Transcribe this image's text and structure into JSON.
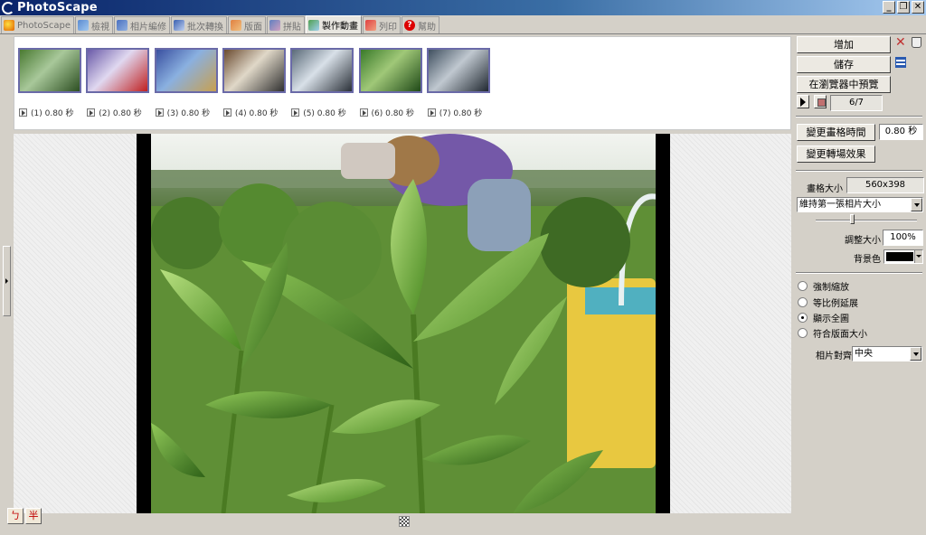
{
  "window": {
    "title": "PhotoScape",
    "controls": [
      "_",
      "❐",
      "✕"
    ]
  },
  "tabs": [
    {
      "label": "PhotoScape",
      "icon": "photoscape-icon",
      "active": false
    },
    {
      "label": "檢視",
      "icon": "viewer-icon",
      "active": false
    },
    {
      "label": "相片編修",
      "icon": "editor-icon",
      "active": false
    },
    {
      "label": "批次轉換",
      "icon": "batch-icon",
      "active": false
    },
    {
      "label": "版面",
      "icon": "page-icon",
      "active": false
    },
    {
      "label": "拼貼",
      "icon": "combine-icon",
      "active": false
    },
    {
      "label": "製作動畫",
      "icon": "gif-icon",
      "active": true
    },
    {
      "label": "列印",
      "icon": "print-icon",
      "active": false
    },
    {
      "label": "幫助",
      "icon": "help-icon",
      "active": false
    }
  ],
  "frames": [
    {
      "label": "(1) 0.80 秒",
      "colors": [
        "#4a7a32",
        "#a8c89a",
        "#2d4f22"
      ]
    },
    {
      "label": "(2) 0.80 秒",
      "colors": [
        "#6a5aa8",
        "#e0d8f0",
        "#c02020"
      ]
    },
    {
      "label": "(3) 0.80 秒",
      "colors": [
        "#3a50a0",
        "#8ab0e0",
        "#c8a050"
      ]
    },
    {
      "label": "(4) 0.80 秒",
      "colors": [
        "#6a4a30",
        "#e0d8c8",
        "#303030"
      ]
    },
    {
      "label": "(5) 0.80 秒",
      "colors": [
        "#5a6a78",
        "#d8e0e8",
        "#2a3038"
      ]
    },
    {
      "label": "(6) 0.80 秒",
      "colors": [
        "#3a7a2a",
        "#a0c878",
        "#204a18"
      ]
    },
    {
      "label": "(7) 0.80 秒",
      "colors": [
        "#405060",
        "#c0c8d0",
        "#202830"
      ]
    }
  ],
  "panel": {
    "add_label": "增加",
    "save_label": "儲存",
    "preview_browser_label": "在瀏覽器中預覽",
    "frame_counter": "6/7",
    "change_time_label": "變更畫格時間",
    "time_value": "0.80 秒",
    "change_effect_label": "變更轉場效果",
    "frame_size_label": "畫格大小",
    "frame_size_value": "560x398",
    "size_mode_selected": "維持第一張相片大小",
    "resize_label": "調整大小",
    "resize_value": "100%",
    "bgcolor_label": "背景色",
    "bgcolor_value": "#000000",
    "radio_options": [
      {
        "label": "強制縮放",
        "checked": false
      },
      {
        "label": "等比例延展",
        "checked": false
      },
      {
        "label": "顯示全圖",
        "checked": true
      },
      {
        "label": "符合版面大小",
        "checked": false
      }
    ],
    "align_label": "相片對齊",
    "align_selected": "中央",
    "resize_slider_fraction": 0.36
  },
  "ime": [
    "ㄅ",
    "半"
  ]
}
